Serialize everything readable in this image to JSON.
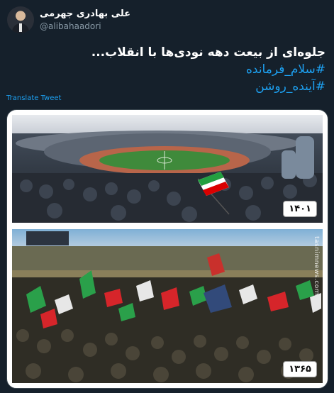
{
  "author": {
    "name": "علی بهادری جهرمی",
    "handle": "@alibahaadori"
  },
  "tweet": {
    "line1": "جلوه‌ای از بیعت دهه نودی‌ها با انقلاب...",
    "hashtags": [
      "#سلام_فرمانده",
      "#آینده_روشن"
    ]
  },
  "translate_label": "Translate Tweet",
  "media": {
    "photos": [
      {
        "year_label": "۱۴۰۱"
      },
      {
        "year_label": "۱۳۶۵",
        "watermark": "tasnimnews.com"
      }
    ]
  },
  "colors": {
    "background": "#15202b",
    "link": "#1da1f2",
    "secondary_text": "#8899a6"
  }
}
